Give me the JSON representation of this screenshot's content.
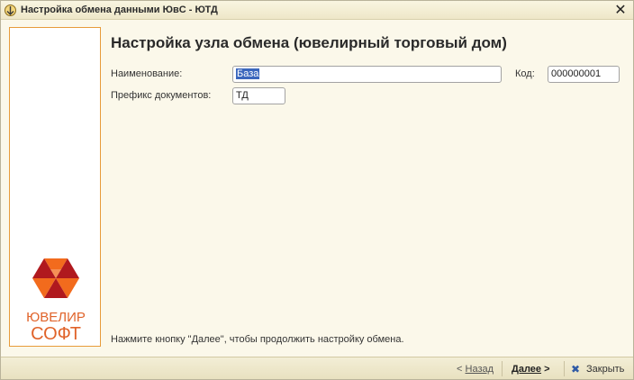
{
  "window": {
    "title": "Настройка обмена данными ЮвС - ЮТД",
    "close_label": "✕"
  },
  "logo": {
    "line1": "ЮВЕЛИР",
    "line2": "СОФТ",
    "colors": {
      "orange": "#f26b1d",
      "red": "#b0191e",
      "text": "#e0632a"
    }
  },
  "header": {
    "title": "Настройка узла обмена (ювелирный торговый дом)"
  },
  "form": {
    "name_label": "Наименование:",
    "name_value": "База",
    "code_label": "Код:",
    "code_value": "000000001",
    "prefix_label": "Префикс документов:",
    "prefix_value": "ТД"
  },
  "hint": "Нажмите кнопку \"Далее\", чтобы продолжить настройку обмена.",
  "buttons": {
    "back_arrow": "<",
    "back_label": "Назад",
    "next_label": "Далее",
    "next_arrow": ">",
    "close_label": "Закрыть"
  }
}
